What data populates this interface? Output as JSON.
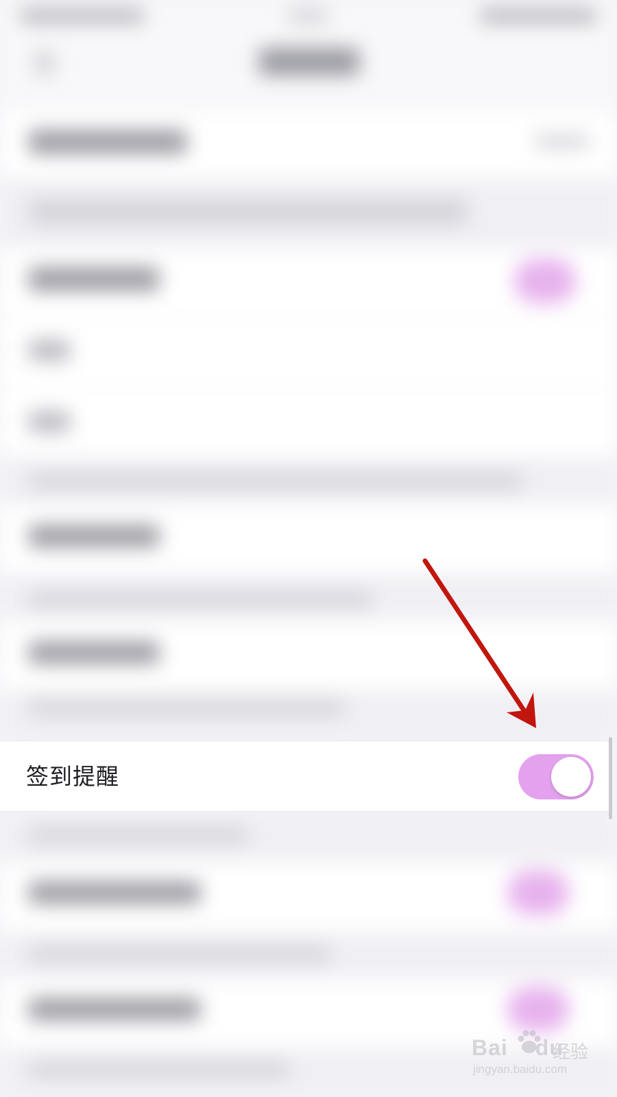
{
  "focused_setting": {
    "label": "签到提醒",
    "enabled": true
  },
  "watermark": {
    "brand_left": "Bai",
    "brand_right": "du",
    "product": "经验",
    "url": "jingyan.baidu.com"
  },
  "colors": {
    "toggle_on": "#e3a1ee",
    "arrow": "#c0160d",
    "background": "#f3f2f6"
  },
  "icons": {
    "arrow": "annotation-arrow-icon",
    "watermark": "baidu-paw-icon"
  }
}
